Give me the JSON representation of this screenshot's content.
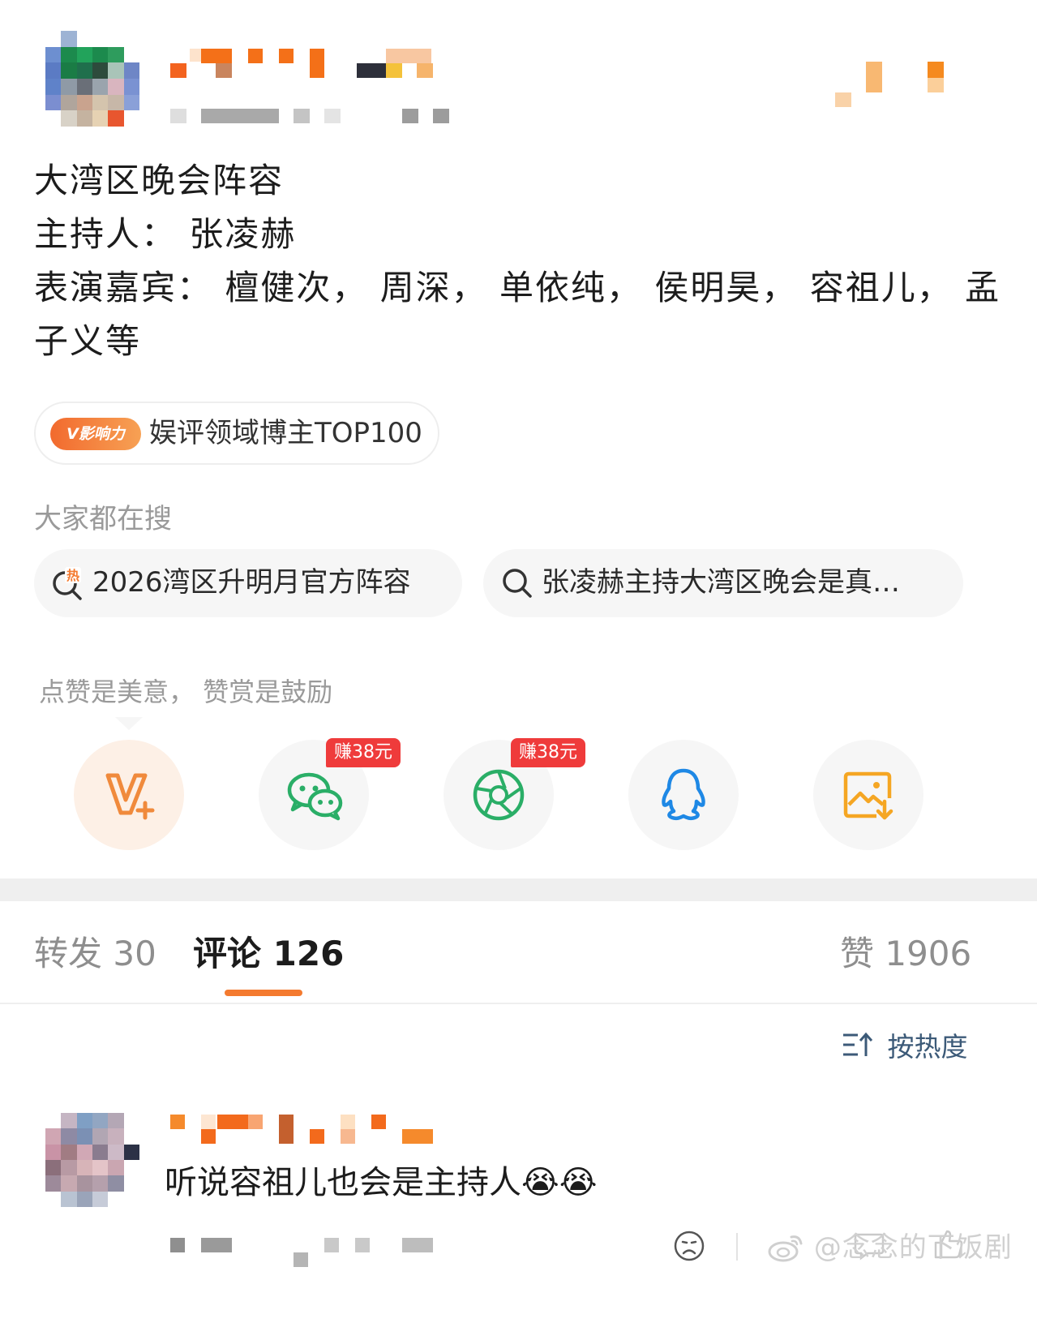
{
  "post": {
    "lines": [
      "大湾区晚会阵容",
      "主持人：  张凌赫",
      "表演嘉宾：  檀健次，  周深，  单依纯，  侯明昊，  容祖儿，  孟",
      "子义等"
    ]
  },
  "badge": {
    "tag": "V影响力",
    "text": "娱评领域博主TOP100"
  },
  "search": {
    "label": "大家都在搜",
    "items": [
      {
        "icon": "hot-search-icon",
        "text": "2026湾区升明月官方阵容"
      },
      {
        "icon": "search-icon",
        "text": "张凌赫主持大湾区晚会是真…"
      }
    ]
  },
  "reward": {
    "label": "点赞是美意，  赞赏是鼓励",
    "buttons": [
      {
        "icon": "v-plus-icon",
        "color": "#f08a3c"
      },
      {
        "icon": "wechat-icon",
        "color": "#2aae67",
        "earn": "赚38元"
      },
      {
        "icon": "moments-icon",
        "color": "#2aae67",
        "earn": "赚38元"
      },
      {
        "icon": "qq-icon",
        "color": "#1e88e5"
      },
      {
        "icon": "save-image-icon",
        "color": "#f5a623"
      }
    ]
  },
  "tabs": {
    "repost": "转发 30",
    "comment": "评论 126",
    "like": "赞 1906"
  },
  "sort_label": "按热度",
  "comment": {
    "text": "听说容祖儿也会是主持人",
    "emoji": [
      "😭",
      "😭"
    ]
  },
  "watermark": "@念念的下饭剧",
  "colors": {
    "accent": "#f47a2f",
    "earn_tag": "#ef3b3b",
    "sort_text": "#3c5a78"
  }
}
